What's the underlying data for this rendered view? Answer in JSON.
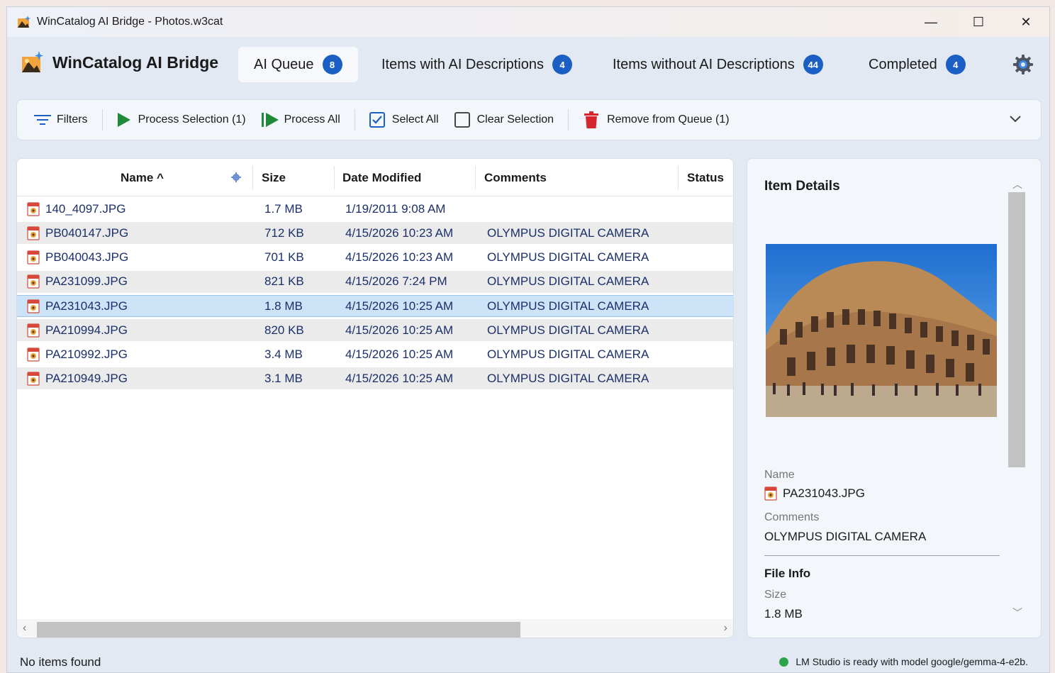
{
  "window": {
    "title": "WinCatalog AI Bridge - Photos.w3cat",
    "controls": {
      "minimize": "—",
      "maximize": "☐",
      "close": "✕"
    }
  },
  "header": {
    "brand": "WinCatalog AI Bridge",
    "tabs": [
      {
        "label": "AI Queue",
        "count": "8",
        "active": true
      },
      {
        "label": "Items with AI Descriptions",
        "count": "4"
      },
      {
        "label": "Items without AI Descriptions",
        "count": "44"
      },
      {
        "label": "Completed",
        "count": "4"
      }
    ],
    "settings_icon": "gear-icon"
  },
  "toolbar": {
    "filters": "Filters",
    "process_selection": "Process Selection (1)",
    "process_all": "Process All",
    "select_all": "Select All",
    "clear_selection": "Clear Selection",
    "remove_from_queue": "Remove from Queue (1)"
  },
  "grid": {
    "columns": {
      "name": "Name ^",
      "size": "Size",
      "date": "Date Modified",
      "comments": "Comments",
      "status": "Status"
    },
    "rows": [
      {
        "name": "140_4097.JPG",
        "size": "1.7 MB",
        "date": "1/19/2011 9:08 AM",
        "comments": ""
      },
      {
        "name": "PB040147.JPG",
        "size": "712 KB",
        "date": "4/15/2026 10:23 AM",
        "comments": "OLYMPUS DIGITAL CAMERA"
      },
      {
        "name": "PB040043.JPG",
        "size": "701 KB",
        "date": "4/15/2026 10:23 AM",
        "comments": "OLYMPUS DIGITAL CAMERA"
      },
      {
        "name": "PA231099.JPG",
        "size": "821 KB",
        "date": "4/15/2026 7:24 PM",
        "comments": "OLYMPUS DIGITAL CAMERA"
      },
      {
        "name": "PA231043.JPG",
        "size": "1.8 MB",
        "date": "4/15/2026 10:25 AM",
        "comments": "OLYMPUS DIGITAL CAMERA",
        "selected": true
      },
      {
        "name": "PA210994.JPG",
        "size": "820 KB",
        "date": "4/15/2026 10:25 AM",
        "comments": "OLYMPUS DIGITAL CAMERA"
      },
      {
        "name": "PA210992.JPG",
        "size": "3.4 MB",
        "date": "4/15/2026 10:25 AM",
        "comments": "OLYMPUS DIGITAL CAMERA"
      },
      {
        "name": "PA210949.JPG",
        "size": "3.1 MB",
        "date": "4/15/2026 10:25 AM",
        "comments": "OLYMPUS DIGITAL CAMERA"
      }
    ]
  },
  "details": {
    "title": "Item Details",
    "name_label": "Name",
    "name_value": "PA231043.JPG",
    "comments_label": "Comments",
    "comments_value": "OLYMPUS DIGITAL CAMERA",
    "file_info_label": "File Info",
    "size_label": "Size",
    "size_value": "1.8 MB"
  },
  "status": {
    "left": "No items found",
    "right": "LM Studio is ready with model google/gemma-4-e2b.",
    "indicator_color": "#2aa34a"
  },
  "colors": {
    "accent": "#1c5fc4",
    "selection": "#cce3f8",
    "link_text": "#1b2f6b"
  }
}
